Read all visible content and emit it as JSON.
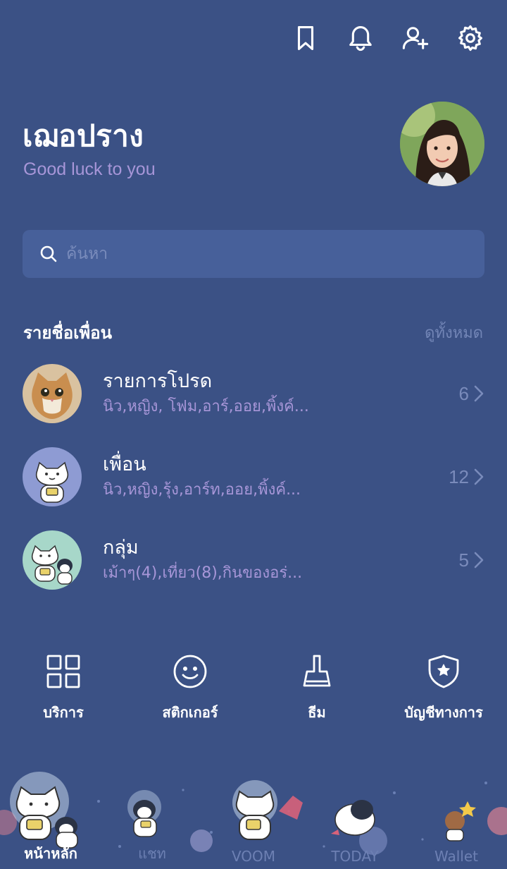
{
  "topbar": {
    "icons": [
      "bookmark-icon",
      "bell-icon",
      "add-friend-icon",
      "gear-icon"
    ]
  },
  "profile": {
    "name": "เฌอปราง",
    "status": "Good luck to you"
  },
  "search": {
    "placeholder": "ค้นหา"
  },
  "friends_section": {
    "title": "รายชื่อเพื่อน",
    "see_all": "ดูทั้งหมด",
    "rows": [
      {
        "title": "รายการโปรด",
        "subtitle": "นิว,หญิง, โฟม,อาร์,ออย,พิ้งค์...",
        "count": "6"
      },
      {
        "title": "เพื่อน",
        "subtitle": "นิว,หญิง,รุ้ง,อาร์ท,ออย,พิ้งค์...",
        "count": "12"
      },
      {
        "title": "กลุ่ม",
        "subtitle": "เม้าๆ(4),เที่ยว(8),กินของอร่...",
        "count": "5"
      }
    ]
  },
  "services": [
    {
      "label": "บริการ",
      "icon": "grid-icon"
    },
    {
      "label": "สติกเกอร์",
      "icon": "smiley-icon"
    },
    {
      "label": "ธีม",
      "icon": "brush-icon"
    },
    {
      "label": "บัญชีทางการ",
      "icon": "shield-star-icon"
    }
  ],
  "tabs": [
    {
      "label": "หน้าหลัก",
      "active": true
    },
    {
      "label": "แชท",
      "active": false
    },
    {
      "label": "VOOM",
      "active": false
    },
    {
      "label": "TODAY",
      "active": false
    },
    {
      "label": "Wallet",
      "active": false
    }
  ],
  "colors": {
    "background": "#3b5185",
    "accent_text": "#a796d8",
    "muted_text": "#7285b6",
    "search_bg": "#47609a"
  }
}
